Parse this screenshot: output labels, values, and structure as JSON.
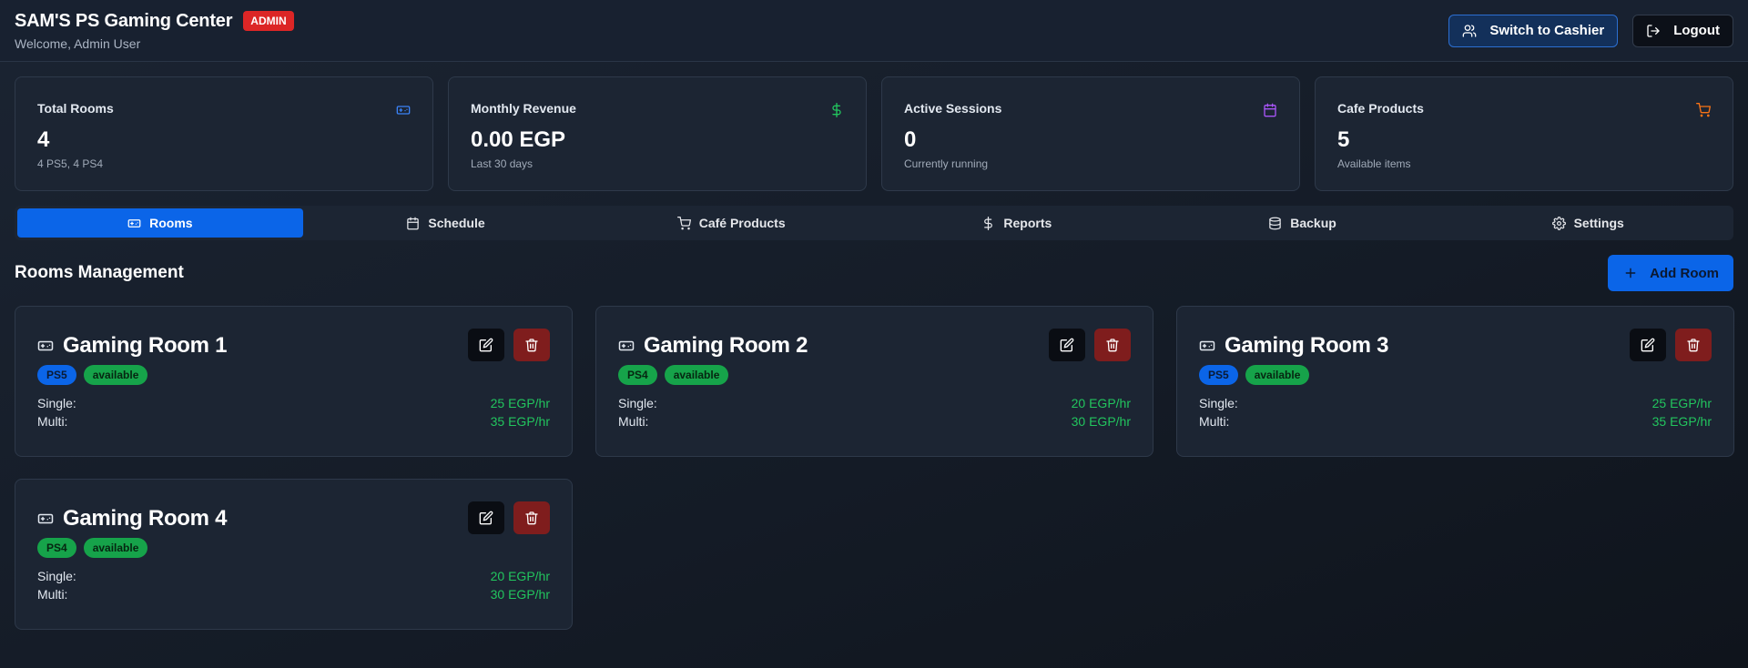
{
  "header": {
    "title": "SAM'S PS Gaming Center",
    "badge": "ADMIN",
    "welcome": "Welcome, Admin User",
    "switch_label": "Switch to Cashier",
    "logout_label": "Logout"
  },
  "stats": [
    {
      "label": "Total Rooms",
      "value": "4",
      "sub": "4 PS5, 4 PS4",
      "icon": "gamepad-icon",
      "color": "#3b82f6"
    },
    {
      "label": "Monthly Revenue",
      "value": "0.00 EGP",
      "sub": "Last 30 days",
      "icon": "dollar-icon",
      "color": "#22c55e"
    },
    {
      "label": "Active Sessions",
      "value": "0",
      "sub": "Currently running",
      "icon": "calendar-icon",
      "color": "#a855f7"
    },
    {
      "label": "Cafe Products",
      "value": "5",
      "sub": "Available items",
      "icon": "cart-icon",
      "color": "#f97316"
    }
  ],
  "tabs": [
    {
      "label": "Rooms",
      "icon": "gamepad-icon",
      "active": true
    },
    {
      "label": "Schedule",
      "icon": "calendar-icon"
    },
    {
      "label": "Café Products",
      "icon": "cart-icon"
    },
    {
      "label": "Reports",
      "icon": "dollar-icon"
    },
    {
      "label": "Backup",
      "icon": "database-icon"
    },
    {
      "label": "Settings",
      "icon": "gear-icon"
    }
  ],
  "section": {
    "title": "Rooms Management",
    "add_label": "Add Room"
  },
  "labels": {
    "single": "Single:",
    "multi": "Multi:"
  },
  "rooms": [
    {
      "name": "Gaming Room 1",
      "console": "PS5",
      "status": "available",
      "single": "25 EGP/hr",
      "multi": "35 EGP/hr"
    },
    {
      "name": "Gaming Room 2",
      "console": "PS4",
      "status": "available",
      "single": "20 EGP/hr",
      "multi": "30 EGP/hr"
    },
    {
      "name": "Gaming Room 3",
      "console": "PS5",
      "status": "available",
      "single": "25 EGP/hr",
      "multi": "35 EGP/hr"
    },
    {
      "name": "Gaming Room 4",
      "console": "PS4",
      "status": "available",
      "single": "20 EGP/hr",
      "multi": "30 EGP/hr"
    }
  ]
}
